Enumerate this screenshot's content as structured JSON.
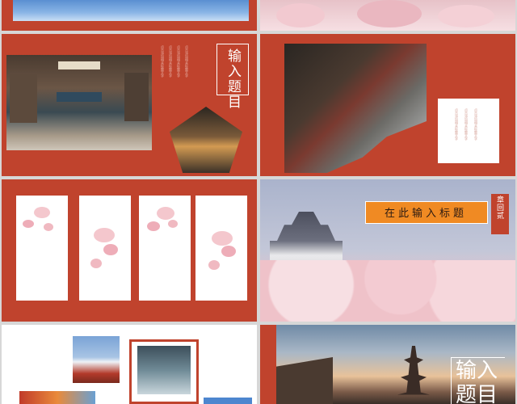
{
  "slides": {
    "s3": {
      "title": "输入题目",
      "caption": "点击添加相关标题文字"
    },
    "s6": {
      "banner": "在此输入标题",
      "side_label": "章回贰"
    },
    "s8": {
      "title": "输入题目"
    }
  },
  "colors": {
    "brand_red": "#c0432d",
    "banner_orange": "#f08a23",
    "blossom_pink": "#f4c7cd"
  }
}
